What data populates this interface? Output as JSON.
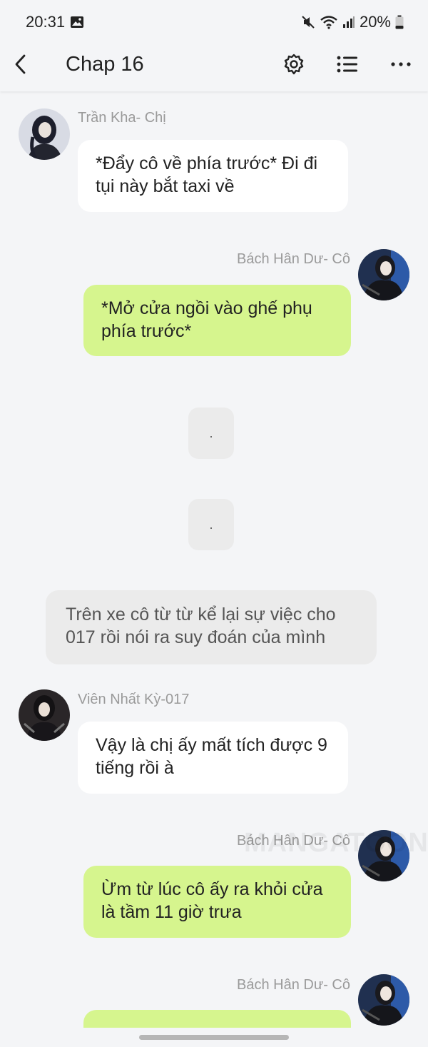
{
  "status_bar": {
    "time": "20:31",
    "battery": "20%"
  },
  "header": {
    "title": "Chap 16",
    "icons": [
      "back-icon",
      "settings-icon",
      "list-icon",
      "more-icon"
    ]
  },
  "messages": [
    {
      "side": "left",
      "sender": "Trần Kha- Chị",
      "text": "*Đẩy cô về phía trước* Đi đi tụi này bắt taxi về"
    },
    {
      "side": "right",
      "sender": "Bách Hân Dư- Cô",
      "text": "*Mở cửa ngồi vào ghế phụ phía trước*"
    },
    {
      "type": "dot",
      "text": "."
    },
    {
      "type": "dot",
      "text": "."
    },
    {
      "type": "narration",
      "text": "Trên xe cô từ từ kể lại sự việc cho 017 rồi nói ra suy đoán của mình"
    },
    {
      "side": "left",
      "sender": "Viên Nhất Kỳ-017",
      "text": "Vậy là chị ấy mất tích được 9 tiếng rồi à"
    },
    {
      "side": "right",
      "sender": "Bách Hân Dư- Cô",
      "text": "Ừm từ lúc cô ấy ra khỏi cửa là tầm 11 giờ trưa"
    },
    {
      "side": "right",
      "sender": "Bách Hân Dư- Cô",
      "text": ""
    }
  ],
  "watermark": "MANGATOON",
  "colors": {
    "background": "#f4f5f7",
    "bubble_left": "#ffffff",
    "bubble_right": "#d6f58e",
    "bubble_narration": "#ebebeb",
    "sender_name": "#9a9a9a"
  }
}
